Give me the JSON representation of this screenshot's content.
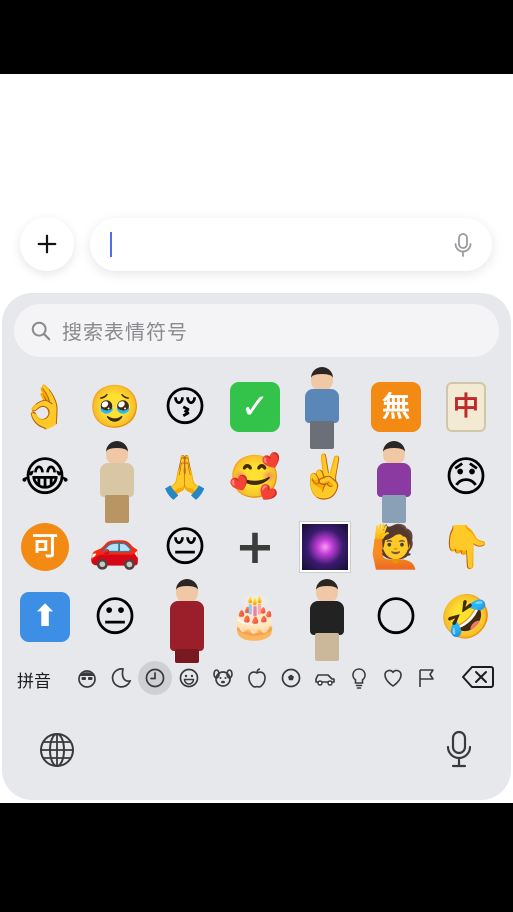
{
  "composer": {
    "input_value": ""
  },
  "search": {
    "placeholder": "搜索表情符号"
  },
  "emoji_rows": [
    [
      "👌",
      "🥹",
      "😚",
      "✅",
      "memoji-blue",
      "🈚",
      "🀄",
      ""
    ],
    [
      "😂",
      "memoji-beige",
      "🙏",
      "🥰",
      "✌️",
      "memoji-purple",
      "😞",
      ""
    ],
    [
      "🉑",
      "🚗",
      "😔",
      "➕",
      "🎆",
      "🙋",
      "👇",
      ""
    ],
    [
      "⬆️",
      "😐",
      "memoji-red",
      "🎂",
      "memoji-black",
      "🌕",
      "🤣",
      ""
    ]
  ],
  "labels": {
    "sq_check": "✓",
    "sq_wu": "無",
    "mahjong": "中",
    "circle_ke": "可",
    "heavy_plus": "+",
    "arrow_up": "⬆"
  },
  "keyboard": {
    "mode_label": "拼音",
    "categories": [
      "memoji-icon",
      "sticker-icon",
      "recent-icon",
      "smileys-icon",
      "animals-icon",
      "food-icon",
      "activity-icon",
      "travel-icon",
      "objects-icon",
      "symbols-icon",
      "flags-icon"
    ],
    "active_category": "recent-icon"
  },
  "colors": {
    "accent_caret": "#4f6ff0",
    "panel_bg": "#e7e8ec",
    "active_tab_bg": "#cfd0d4"
  }
}
